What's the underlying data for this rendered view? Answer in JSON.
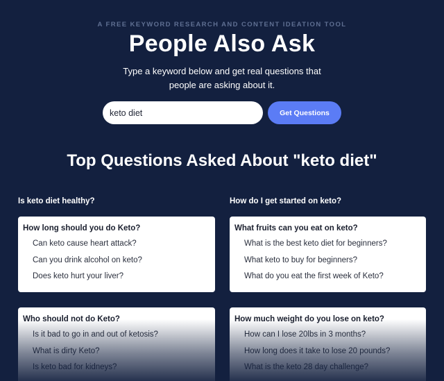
{
  "hero": {
    "eyebrow": "A FREE KEYWORD RESEARCH AND CONTENT IDEATION TOOL",
    "title": "People Also Ask",
    "subtitle_line1": "Type a keyword below and get real questions that",
    "subtitle_line2": "people are asking about it."
  },
  "search": {
    "value": "keto diet",
    "button_label": "Get Questions"
  },
  "results": {
    "section_title": "Top Questions Asked About \"keto diet\"",
    "columns": [
      {
        "heading": "Is keto diet healthy?",
        "cards": [
          {
            "title": "How long should you do Keto?",
            "items": [
              "Can keto cause heart attack?",
              "Can you drink alcohol on keto?",
              "Does keto hurt your liver?"
            ]
          },
          {
            "title": "Who should not do Keto?",
            "items": [
              "Is it bad to go in and out of ketosis?",
              "What is dirty Keto?",
              "Is keto bad for kidneys?"
            ]
          }
        ]
      },
      {
        "heading": "How do I get started on keto?",
        "cards": [
          {
            "title": "What fruits can you eat on keto?",
            "items": [
              "What is the best keto diet for beginners?",
              "What keto to buy for beginners?",
              "What do you eat the first week of Keto?"
            ]
          },
          {
            "title": "How much weight do you lose on keto?",
            "items": [
              "How can I lose 20lbs in 3 months?",
              "How long does it take to lose 20 pounds?",
              "What is the keto 28 day challenge?"
            ]
          }
        ]
      }
    ]
  },
  "colors": {
    "background": "#13203f",
    "accent": "#5b7cf5",
    "eyebrow": "#5f6f92"
  }
}
